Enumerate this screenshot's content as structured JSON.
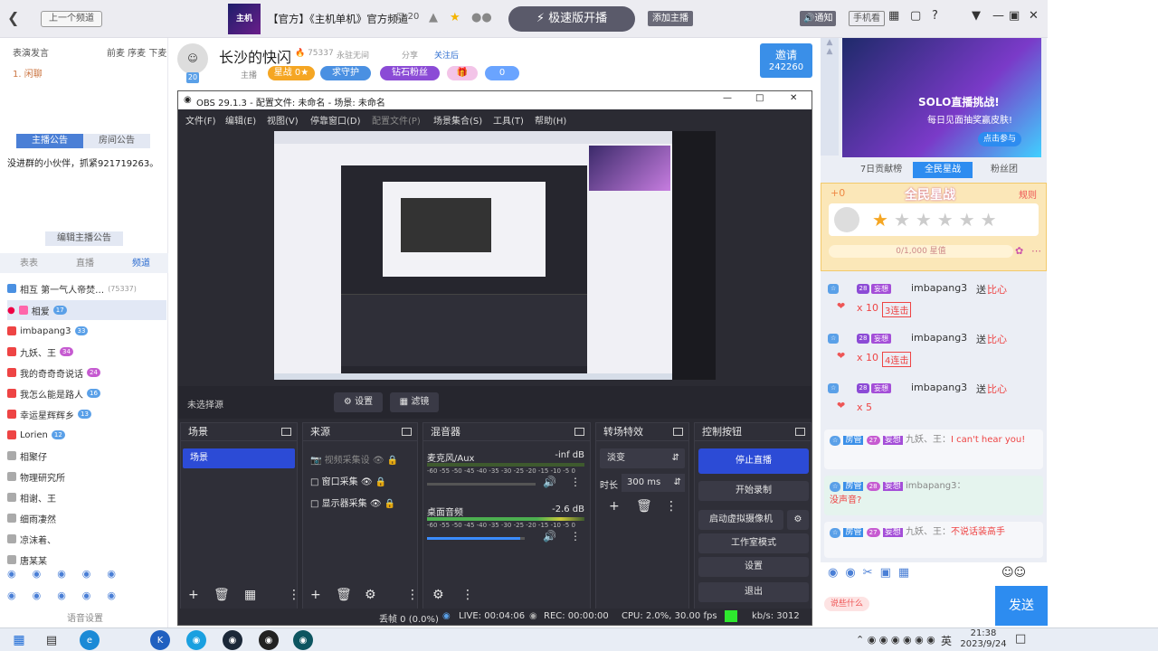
{
  "topbar": {
    "prev_label": "上一个频道",
    "title": "【官方】《主机单机》官方频道",
    "member_count": "20",
    "fast_label": "极速版开播",
    "add_fav_label": "添加主播",
    "notice_label": "通知",
    "phone_label": "手机看"
  },
  "channel": {
    "name": "长沙的快闪",
    "hot_count": "75337",
    "no_frame": "永驻无间",
    "share": "分享",
    "follow": "关注后",
    "sub_label": "主播",
    "star_label": "星战",
    "star_count": "0",
    "guard_label": "求守护",
    "diamond_label": "钻石粉丝",
    "count_0": "0",
    "avatar_num": "20",
    "invite_label": "邀请",
    "invite_count": "242260"
  },
  "left": {
    "header_l": "表演发言",
    "header_r": "前麦 序麦 下麦",
    "mic_row": "1. 闲聊",
    "tab_notice": "主播公告",
    "tab_room": "房间公告",
    "notice_text": "没进群的小伙伴，抓紧921719263。",
    "edit_notice": "编辑主播公告",
    "tabs": [
      "表表",
      "直播",
      "频道"
    ],
    "first_row": "相互 第一气人帝焚…",
    "first_count": "(75337)",
    "users": [
      "相爱",
      "imbapang3",
      "九妖、王",
      "我的奇奇奇说话",
      "我怎么能是路人",
      "幸运星辉辉乡",
      "Lorien",
      "相聚仔",
      "物理研究所",
      "相谢、王",
      "细雨凄然",
      "凉沫着、",
      "唐某某"
    ],
    "footer": "语音设置"
  },
  "obs": {
    "title": "OBS 29.1.3 - 配置文件: 未命名 - 场景: 未命名",
    "menu": [
      "文件(F)",
      "编辑(E)",
      "视图(V)",
      "停靠窗口(D)",
      "配置文件(P)",
      "场景集合(S)",
      "工具(T)",
      "帮助(H)"
    ],
    "no_source": "未选择源",
    "settings_label": "设置",
    "filters_label": "滤镜",
    "docks": {
      "scenes": "场景",
      "sources": "来源",
      "mixer": "混音器",
      "transitions": "转场特效",
      "controls": "控制按钮"
    },
    "scene_item": "场景",
    "sources": [
      "视频采集设",
      "窗口采集",
      "显示器采集"
    ],
    "mixer": [
      {
        "name": "麦克风/Aux",
        "db": "-inf dB",
        "level": 0.0
      },
      {
        "name": "桌面音频",
        "db": "-2.6 dB",
        "level": 0.95
      }
    ],
    "scale": "-60 -55 -50 -45 -40 -35 -30 -25 -20 -15 -10 -5 0",
    "transition_name": "淡变",
    "duration_label": "时长",
    "duration_value": "300 ms",
    "controls": [
      "停止直播",
      "开始录制",
      "启动虚拟摄像机",
      "工作室模式",
      "设置",
      "退出"
    ],
    "status": {
      "dropped": "丢帧 0 (0.0%)",
      "live": "LIVE: 00:04:06",
      "rec": "REC: 00:00:00",
      "cpu": "CPU: 2.0%, 30.00 fps",
      "kbs": "kb/s: 3012"
    }
  },
  "right": {
    "promo_text": "SOLO直播挑战!",
    "promo_sub": "每日见面抽奖赢皮肤!",
    "promo_btn": "点击参与",
    "tabs": [
      "7日贡献榜",
      "全民星战",
      "粉丝团"
    ],
    "star_title": "全民星战",
    "star_plus": "+0",
    "star_rule": "规则",
    "progress": "0/1,000 星值",
    "gifts": [
      {
        "user": "imbapang3",
        "send": "送",
        "gift": "比心",
        "count": "x 10",
        "combo": "3连击"
      },
      {
        "user": "imbapang3",
        "send": "送",
        "gift": "比心",
        "count": "x 10",
        "combo": "4连击"
      },
      {
        "user": "imbapang3",
        "send": "送",
        "gift": "比心",
        "count": "x 5",
        "combo": ""
      }
    ],
    "messages": [
      {
        "role": "房管",
        "lv": "27",
        "tag": "妄想",
        "user": "九妖、王：",
        "text": "I can't hear you!"
      },
      {
        "role": "房管",
        "lv": "28",
        "tag": "妄想",
        "user": "imbapang3：",
        "text": "没声音?"
      },
      {
        "role": "房管",
        "lv": "27",
        "tag": "妄想",
        "user": "九妖、王：",
        "text": "不说话装高手"
      }
    ],
    "greet": "说些什么",
    "send": "发送"
  },
  "taskbar": {
    "time": "21:38",
    "date": "2023/9/24",
    "lang": "英"
  },
  "colors": {
    "obs_bg": "#2b2b33",
    "obs_blue": "#2c4bd6",
    "accent_blue": "#2d8cf0",
    "send_blue": "#2d8cf0"
  }
}
